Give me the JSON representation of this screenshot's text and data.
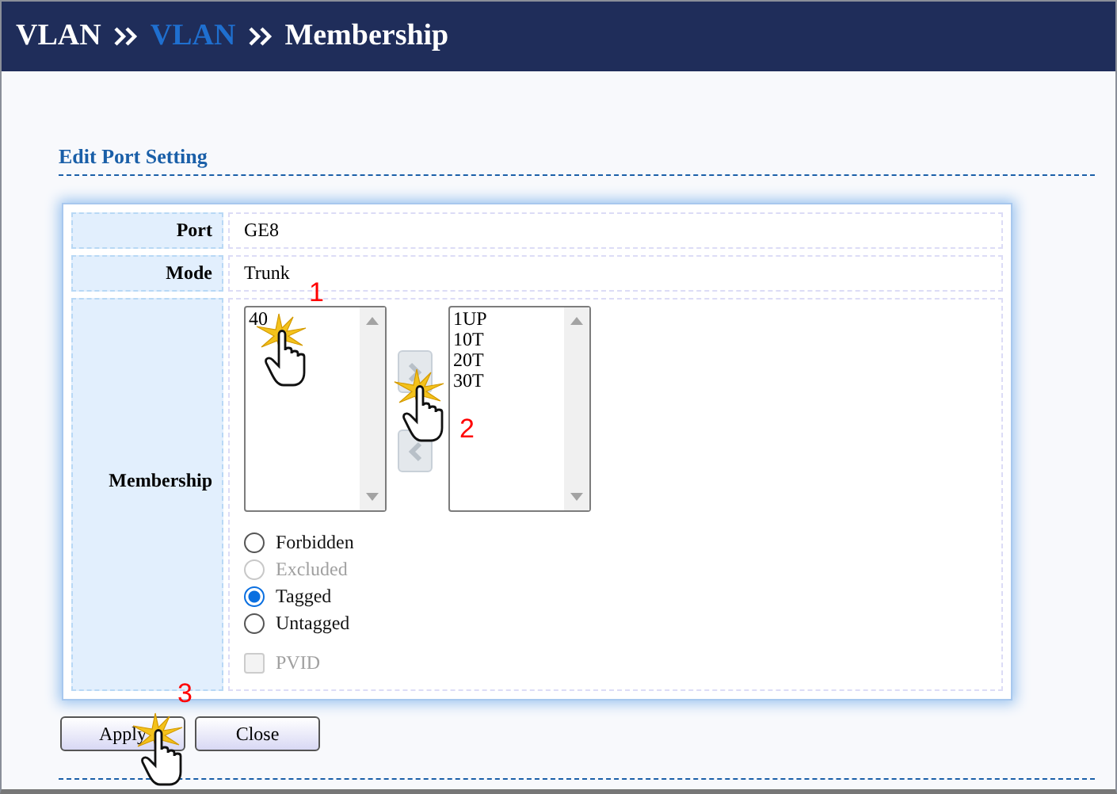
{
  "breadcrumb": [
    {
      "text": "VLAN",
      "kind": "text"
    },
    {
      "text": "VLAN",
      "kind": "link"
    },
    {
      "text": "Membership",
      "kind": "text"
    }
  ],
  "section_title": "Edit Port Setting",
  "fields": [
    {
      "label": "Port",
      "value": "GE8"
    },
    {
      "label": "Mode",
      "value": "Trunk"
    }
  ],
  "membership": {
    "label": "Membership",
    "available": [
      "40"
    ],
    "members": [
      "1UP",
      "10T",
      "20T",
      "30T"
    ],
    "options": [
      {
        "label": "Forbidden",
        "selected": false,
        "disabled": false
      },
      {
        "label": "Excluded",
        "selected": false,
        "disabled": true
      },
      {
        "label": "Tagged",
        "selected": true,
        "disabled": false
      },
      {
        "label": "Untagged",
        "selected": false,
        "disabled": false
      }
    ],
    "pvid": {
      "label": "PVID",
      "checked": false,
      "disabled": true
    }
  },
  "buttons": [
    "Apply",
    "Close"
  ],
  "annotations": [
    {
      "label": "1"
    },
    {
      "label": "2"
    },
    {
      "label": "3"
    }
  ]
}
